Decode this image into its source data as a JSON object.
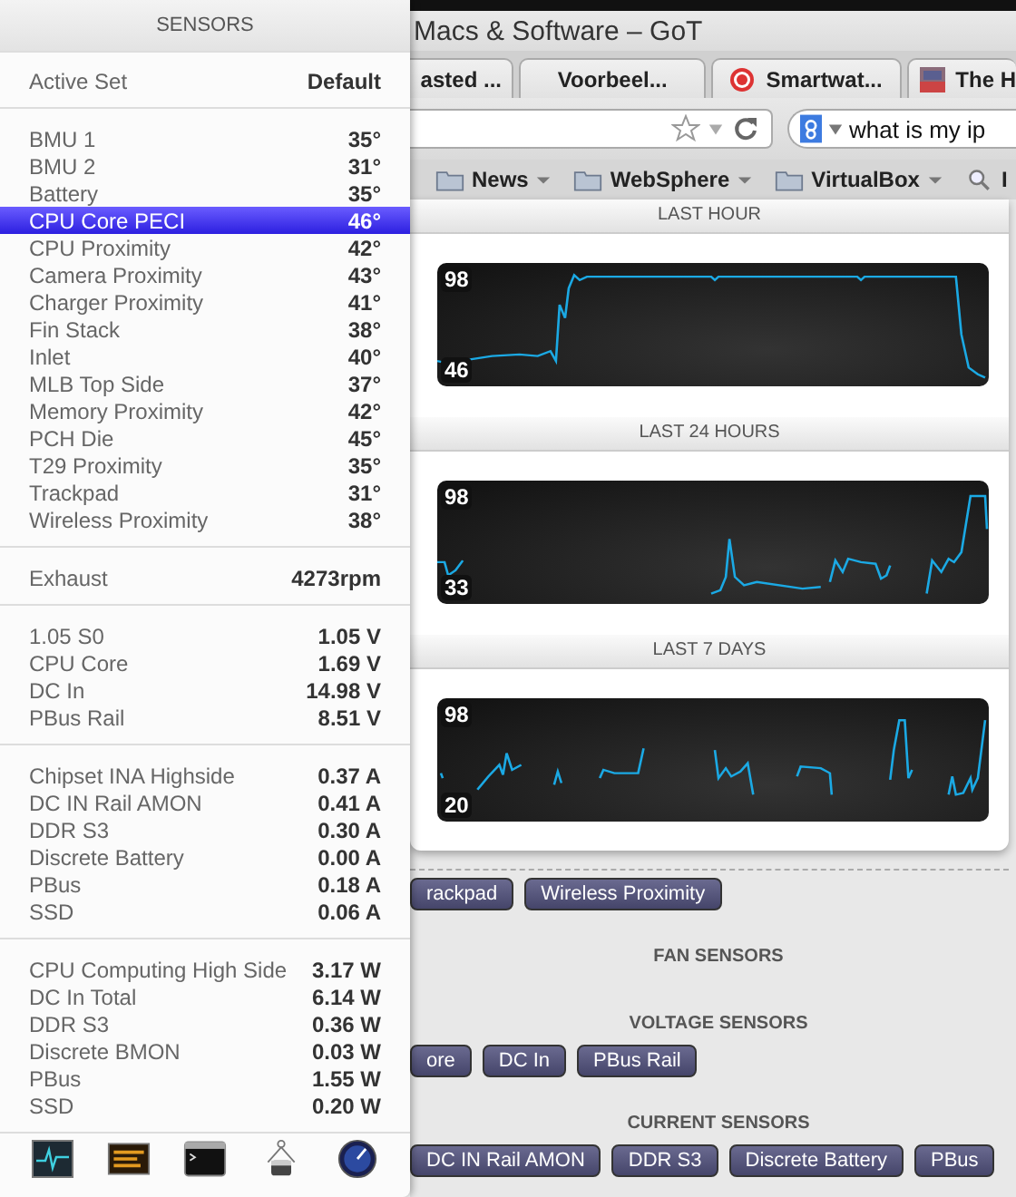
{
  "browser": {
    "window": {
      "title": "Macs & Software – GoT"
    },
    "tabs": [
      {
        "label": "asted ...",
        "kind": "plain"
      },
      {
        "label": "Voorbeel...",
        "kind": "plain"
      },
      {
        "label": "Smartwat...",
        "kind": "favicon"
      },
      {
        "label": "The H",
        "kind": "thumbnail"
      }
    ],
    "search": {
      "value": "what is my ip"
    },
    "bookmarks": [
      {
        "label": "News",
        "kind": "folder"
      },
      {
        "label": "WebSphere",
        "kind": "folder"
      },
      {
        "label": "VirtualBox",
        "kind": "folder"
      },
      {
        "label": "I",
        "kind": "search"
      }
    ],
    "history_charts": [
      {
        "title": "LAST HOUR",
        "max_label": "98",
        "min_label": "46"
      },
      {
        "title": "LAST 24 HOURS",
        "max_label": "98",
        "min_label": "33"
      },
      {
        "title": "LAST 7 DAYS",
        "max_label": "98",
        "min_label": "20"
      }
    ],
    "sensor_sections": [
      {
        "buttons": [
          "rackpad",
          "Wireless Proximity"
        ]
      },
      {
        "title": "FAN SENSORS"
      },
      {
        "title": "VOLTAGE SENSORS",
        "buttons": [
          "ore",
          "DC In",
          "PBus Rail"
        ]
      },
      {
        "title": "CURRENT SENSORS",
        "buttons": [
          "DC IN Rail AMON",
          "DDR S3",
          "Discrete Battery",
          "PBus"
        ]
      }
    ]
  },
  "sensors_menu": {
    "title": "SENSORS",
    "active_set": {
      "label": "Active Set",
      "value": "Default"
    },
    "groups": [
      {
        "items": [
          {
            "name": "BMU 1",
            "value": "35°",
            "selected": false
          },
          {
            "name": "BMU 2",
            "value": "31°",
            "selected": false
          },
          {
            "name": "Battery",
            "value": "35°",
            "selected": false
          },
          {
            "name": "CPU Core PECI",
            "value": "46°",
            "selected": true
          },
          {
            "name": "CPU Proximity",
            "value": "42°",
            "selected": false
          },
          {
            "name": "Camera Proximity",
            "value": "43°",
            "selected": false
          },
          {
            "name": "Charger Proximity",
            "value": "41°",
            "selected": false
          },
          {
            "name": "Fin Stack",
            "value": "38°",
            "selected": false
          },
          {
            "name": "Inlet",
            "value": "40°",
            "selected": false
          },
          {
            "name": "MLB Top Side",
            "value": "37°",
            "selected": false
          },
          {
            "name": "Memory Proximity",
            "value": "42°",
            "selected": false
          },
          {
            "name": "PCH Die",
            "value": "45°",
            "selected": false
          },
          {
            "name": "T29 Proximity",
            "value": "35°",
            "selected": false
          },
          {
            "name": "Trackpad",
            "value": "31°",
            "selected": false
          },
          {
            "name": "Wireless Proximity",
            "value": "38°",
            "selected": false
          }
        ]
      },
      {
        "items": [
          {
            "name": "Exhaust",
            "value": "4273rpm",
            "selected": false
          }
        ]
      },
      {
        "items": [
          {
            "name": "1.05 S0",
            "value": "1.05 V",
            "selected": false
          },
          {
            "name": "CPU Core",
            "value": "1.69 V",
            "selected": false
          },
          {
            "name": "DC In",
            "value": "14.98 V",
            "selected": false
          },
          {
            "name": "PBus Rail",
            "value": "8.51 V",
            "selected": false
          }
        ]
      },
      {
        "items": [
          {
            "name": "Chipset INA Highside",
            "value": "0.37 A",
            "selected": false
          },
          {
            "name": "DC IN Rail AMON",
            "value": "0.41 A",
            "selected": false
          },
          {
            "name": "DDR S3",
            "value": "0.30 A",
            "selected": false
          },
          {
            "name": "Discrete Battery",
            "value": "0.00 A",
            "selected": false
          },
          {
            "name": "PBus",
            "value": "0.18 A",
            "selected": false
          },
          {
            "name": "SSD",
            "value": "0.06 A",
            "selected": false
          }
        ]
      },
      {
        "items": [
          {
            "name": "CPU Computing High Side",
            "value": "3.17 W",
            "selected": false
          },
          {
            "name": "DC In Total",
            "value": "6.14 W",
            "selected": false
          },
          {
            "name": "DDR S3",
            "value": "0.36 W",
            "selected": false
          },
          {
            "name": "Discrete BMON",
            "value": "0.03 W",
            "selected": false
          },
          {
            "name": "PBus",
            "value": "1.55 W",
            "selected": false
          },
          {
            "name": "SSD",
            "value": "0.20 W",
            "selected": false
          }
        ]
      }
    ]
  }
}
